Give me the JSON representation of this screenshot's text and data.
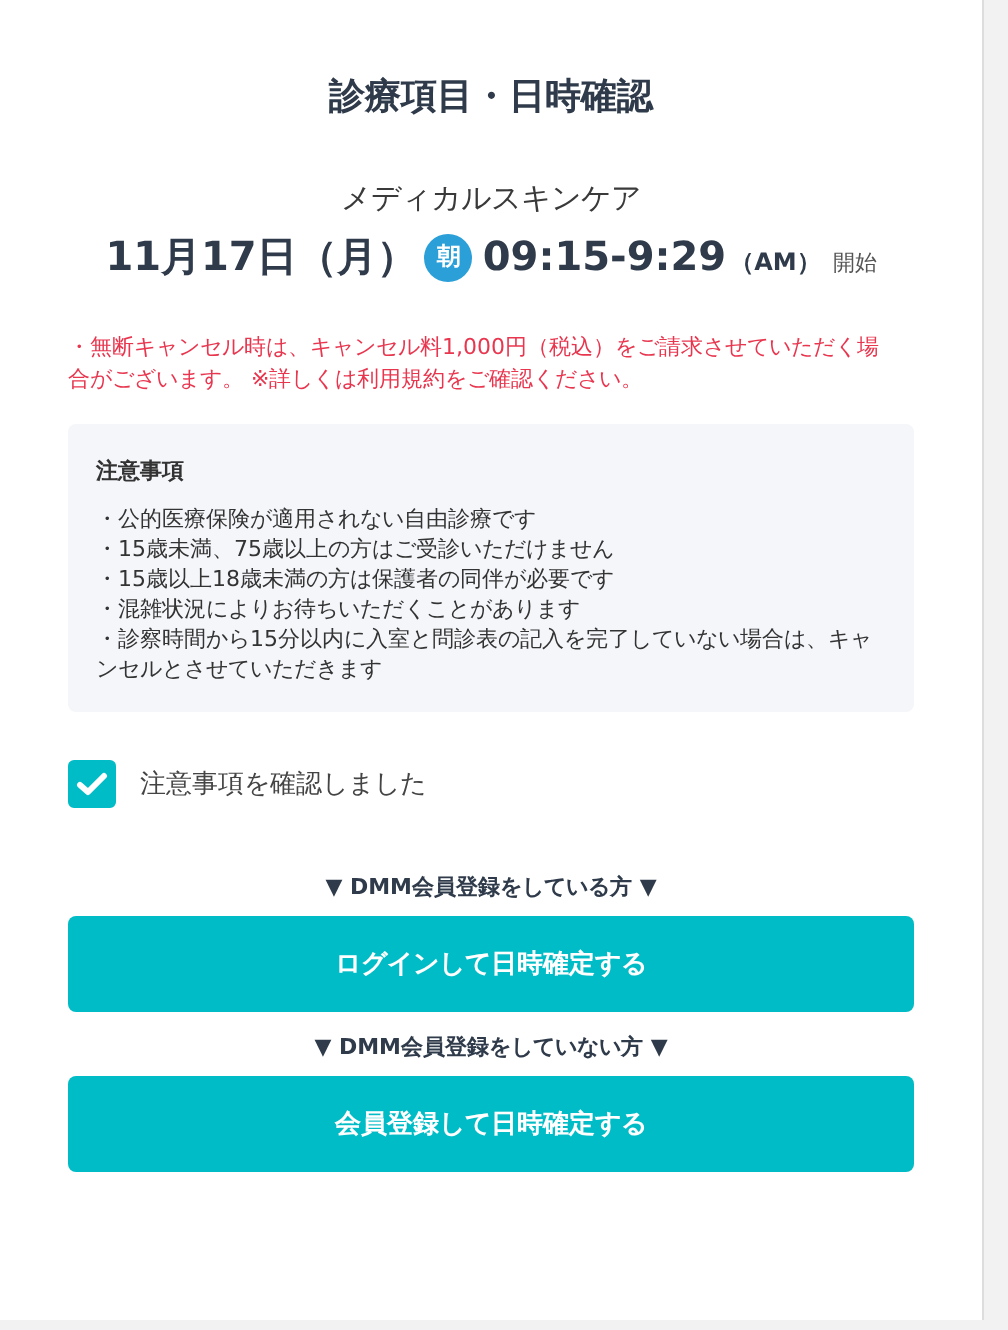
{
  "title": "診療項目・日時確認",
  "menu_name": "メディカルスキンケア",
  "schedule": {
    "date": "11月17日（月）",
    "period_badge": "朝",
    "time": "09:15-9:29",
    "ampm": "（AM）",
    "suffix": "開始"
  },
  "cancel_notice": "・無断キャンセル時は、キャンセル料1,000円（税込）をご請求させていただく場合がございます。 ※詳しくは利用規約をご確認ください。",
  "notes": {
    "heading": "注意事項",
    "items": [
      "・公的医療保険が適用されない自由診療です",
      "・15歳未満、75歳以上の方はご受診いただけません",
      "・15歳以上18歳未満の方は保護者の同伴が必要です",
      "・混雑状況によりお待ちいただくことがあります",
      "・診察時間から15分以内に入室と問診表の記入を完了していない場合は、キャンセルとさせていただきます"
    ]
  },
  "confirm_checkbox": {
    "label": "注意事項を確認しました",
    "checked": true
  },
  "actions": [
    {
      "heading": "▼ DMM会員登録をしている方 ▼",
      "button": "ログインして日時確定する"
    },
    {
      "heading": "▼ DMM会員登録をしていない方 ▼",
      "button": "会員登録して日時確定する"
    }
  ]
}
